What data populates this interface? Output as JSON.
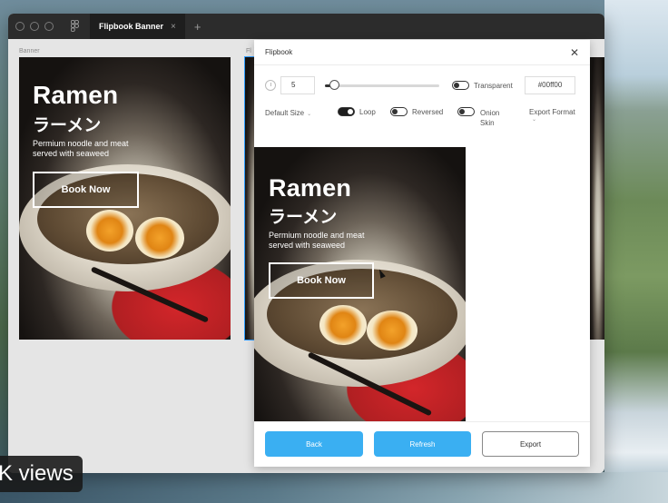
{
  "window": {
    "tab_title": "Flipbook Banner",
    "tab_close": "×",
    "tab_add": "+"
  },
  "canvas": {
    "frame_label": "Banner",
    "frame_label_partial": "Fl"
  },
  "banner": {
    "title": "Ramen",
    "title_jp": "ラーメン",
    "subtitle": "Permium noodle and meat served with seaweed",
    "cta_label": "Book Now"
  },
  "plugin": {
    "title": "Flipbook",
    "close_glyph": "✕",
    "fps_value": "5",
    "slider_fraction": 0.08,
    "transparent_label": "Transparent",
    "transparent_on": false,
    "bg_color_value": "#00ff00",
    "default_size_label": "Default Size",
    "loop_label": "Loop",
    "loop_on": true,
    "reversed_label": "Reversed",
    "reversed_on": false,
    "onion_skin_label": "Onion Skin",
    "onion_skin_on": false,
    "export_format_label": "Export Format",
    "back_label": "Back",
    "refresh_label": "Refresh",
    "export_label": "Export"
  },
  "overlay": {
    "views_text": "K views"
  },
  "colors": {
    "accent_blue": "#3aaff2",
    "titlebar": "#2c2c2c"
  }
}
